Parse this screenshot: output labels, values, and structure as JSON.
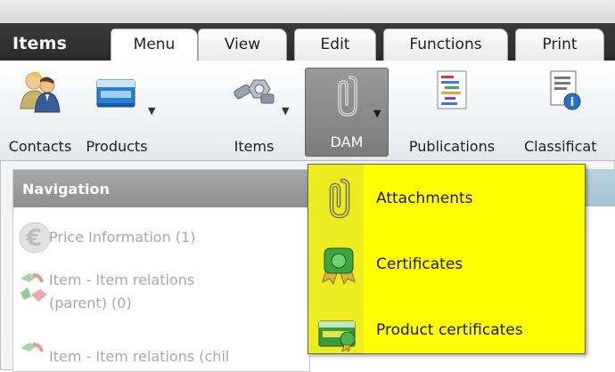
{
  "app_title": "Items",
  "tabs": [
    {
      "label": "Menu",
      "active": true
    },
    {
      "label": "View",
      "active": false
    },
    {
      "label": "Edit",
      "active": false
    },
    {
      "label": "Functions",
      "active": false
    },
    {
      "label": "Print",
      "active": false
    }
  ],
  "ribbon": {
    "buttons": [
      {
        "label": "Contacts",
        "icon": "contacts-icon",
        "has_dropdown": false
      },
      {
        "label": "Products",
        "icon": "products-icon",
        "has_dropdown": true
      },
      {
        "label": "Items",
        "icon": "items-icon",
        "has_dropdown": true
      },
      {
        "label": "DAM",
        "icon": "paperclip-icon",
        "has_dropdown": true,
        "pressed": true
      },
      {
        "label": "Publications",
        "icon": "publications-icon",
        "has_dropdown": false
      },
      {
        "label": "Classificat",
        "icon": "classification-icon",
        "has_dropdown": false
      }
    ]
  },
  "navigation": {
    "title": "Navigation",
    "items": [
      {
        "label": "Price Information (1)",
        "icon": "euro-icon"
      },
      {
        "label_line1": "Item - Item relations",
        "label_line2": "(parent) (0)",
        "icon": "item-relations-icon"
      },
      {
        "label": "Item - Item relations (chil",
        "icon": "item-relations-icon"
      }
    ]
  },
  "dam_menu": {
    "items": [
      {
        "label": "Attachments",
        "icon": "paperclip-icon"
      },
      {
        "label": "Certificates",
        "icon": "certificate-icon"
      },
      {
        "label": "Product certificates",
        "icon": "product-certificate-icon"
      }
    ]
  },
  "colors": {
    "dropdown_highlight": "#ffff00",
    "tabbar": "#2f2f2f",
    "nav_header": "#999999",
    "pressed_button": "#8a8a8a"
  }
}
